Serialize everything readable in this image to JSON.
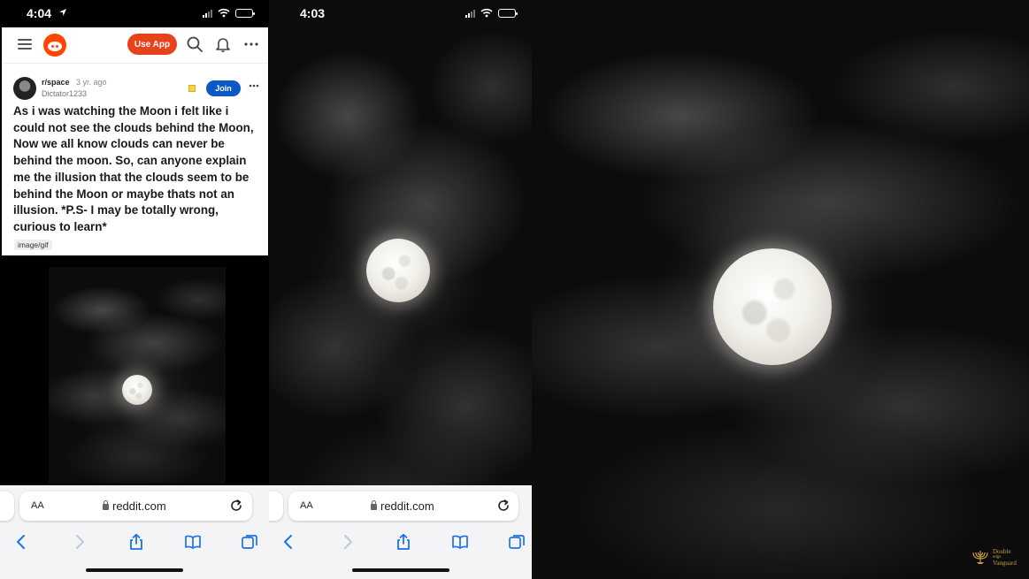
{
  "left_phone": {
    "status_time": "4:04",
    "header": {
      "use_app_label": "Use App"
    },
    "post": {
      "subreddit": "r/space",
      "time_ago": "3 yr. ago",
      "username": "Dictator1233",
      "join_label": "Join",
      "title": "As i was watching the Moon i felt like i could not see the clouds behind the Moon, Now we all know clouds can never be behind the moon. So, can anyone explain me the illusion that the clouds seem to be behind the Moon or maybe thats not an illusion. *P.S- I may be totally wrong, curious to learn*",
      "flair": "image/gif"
    },
    "browser": {
      "aa_label": "AA",
      "url": "reddit.com"
    }
  },
  "middle_phone": {
    "status_time": "4:03",
    "browser": {
      "aa_label": "AA",
      "url": "reddit.com"
    }
  },
  "watermark": {
    "icon": "menorah-icon",
    "line1": "Double",
    "line2": "edge",
    "line3": "Vanguard"
  },
  "colors": {
    "reddit_orange": "#ff4500",
    "use_app_red": "#e8421a",
    "join_blue": "#0b58c6",
    "ios_blue": "#1a73e8"
  }
}
